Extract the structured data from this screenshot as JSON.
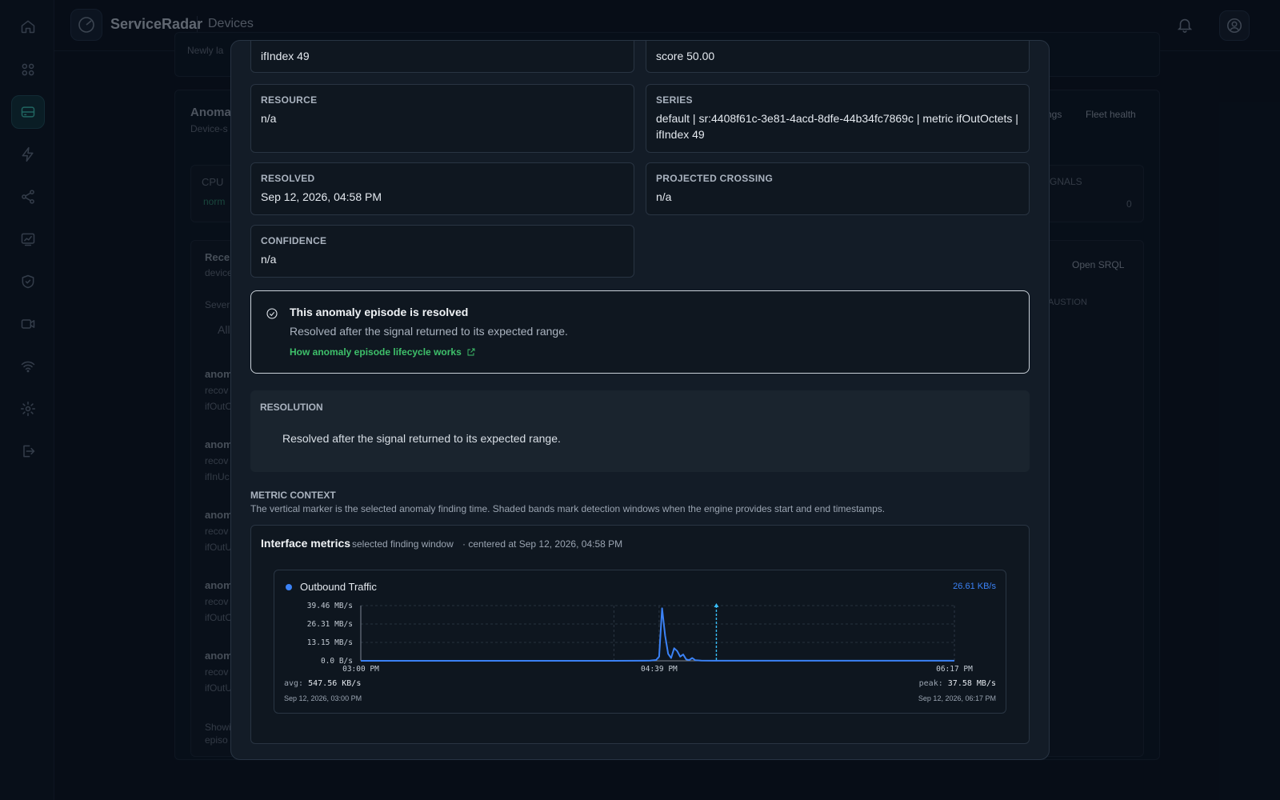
{
  "app": {
    "brand": "ServiceRadar",
    "breadcrumb": "Devices"
  },
  "background": {
    "newly_label": "Newly la",
    "anomalies_title": "Anoma",
    "anomalies_sub": "Device-s",
    "settings_btn": "ngs",
    "fleet_health_btn": "Fleet health",
    "cpu_label": "CPU",
    "norm_badge": "norm",
    "signals_label": "GNALS",
    "signals_count": "0",
    "recent_title": "Rece",
    "recent_sub": "device",
    "open_srql": "Open SRQL",
    "exhaustion_col": "AUSTION",
    "severity_label": "Sever",
    "all_label": "All",
    "list_items": [
      {
        "title": "anom",
        "sub": "recov",
        "metric": "ifOutO"
      },
      {
        "title": "anom",
        "sub": "recov",
        "metric": "ifInUc"
      },
      {
        "title": "anom",
        "sub": "recov",
        "metric": "ifOutU"
      },
      {
        "title": "anom",
        "sub": "recov",
        "metric": "ifOutO"
      },
      {
        "title": "anom",
        "sub": "recov",
        "metric": "ifOutU"
      }
    ],
    "showing": "Showi",
    "episodes": "episo"
  },
  "modal": {
    "top_left_value": "ifIndex 49",
    "top_right_value": "score 50.00",
    "resource": {
      "label": "RESOURCE",
      "value": "n/a"
    },
    "series": {
      "label": "SERIES",
      "value": "default | sr:4408f61c-3e81-4acd-8dfe-44b34fc7869c | metric ifOutOctets | ifIndex 49"
    },
    "resolved": {
      "label": "RESOLVED",
      "value": "Sep 12, 2026, 04:58 PM"
    },
    "projected": {
      "label": "PROJECTED CROSSING",
      "value": "n/a"
    },
    "confidence": {
      "label": "CONFIDENCE",
      "value": "n/a"
    },
    "resolved_notice": {
      "title": "This anomaly episode is resolved",
      "desc": "Resolved after the signal returned to its expected range.",
      "link": "How anomaly episode lifecycle works"
    },
    "resolution": {
      "label": "RESOLUTION",
      "text": "Resolved after the signal returned to its expected range."
    },
    "metric_context": {
      "label": "METRIC CONTEXT",
      "desc": "The vertical marker is the selected anomaly finding time. Shaded bands mark detection windows when the engine provides start and end timestamps."
    },
    "interface_metrics": {
      "title": "Interface metrics",
      "window": "selected finding window",
      "centered": "· centered at Sep 12, 2026, 04:58 PM"
    }
  },
  "chart_data": {
    "type": "line",
    "series": [
      {
        "name": "Outbound Traffic",
        "color": "#3b82f6"
      }
    ],
    "current_value": "26.61 KB/s",
    "y_ticks": [
      "39.46 MB/s",
      "26.31 MB/s",
      "13.15 MB/s",
      "0.0 B/s"
    ],
    "ylim": [
      0,
      39.46
    ],
    "x_ticks": [
      "03:00 PM",
      "04:39 PM",
      "06:17 PM"
    ],
    "xlim": [
      "15:00",
      "18:17"
    ],
    "x": [
      "15:00",
      "16:00",
      "16:24",
      "16:34",
      "16:36",
      "16:38",
      "16:39",
      "16:40",
      "16:41",
      "16:42",
      "16:43",
      "16:44",
      "16:45",
      "16:46",
      "16:47",
      "16:48",
      "16:49",
      "16:50",
      "16:51",
      "16:53",
      "16:57",
      "17:00",
      "18:17"
    ],
    "values": [
      0.02,
      0.02,
      0.02,
      0.05,
      0.1,
      0.6,
      3.0,
      37.5,
      18.0,
      5.0,
      2.0,
      9.0,
      7.0,
      3.0,
      4.5,
      1.0,
      0.5,
      2.0,
      0.4,
      0.1,
      0.05,
      0.03,
      0.03
    ],
    "marker_time": "16:58",
    "avg_label": "avg:",
    "avg_value": "547.56 KB/s",
    "peak_label": "peak:",
    "peak_value": "37.58 MB/s",
    "start_date": "Sep 12, 2026, 03:00 PM",
    "end_date": "Sep 12, 2026, 06:17 PM"
  }
}
